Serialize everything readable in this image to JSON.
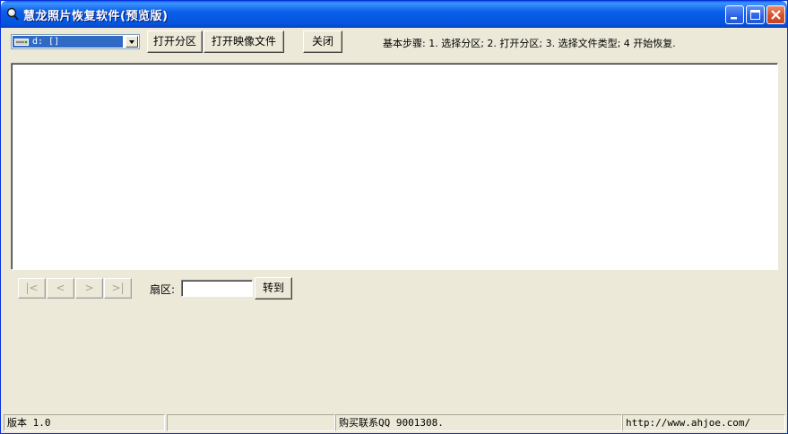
{
  "window": {
    "title": "慧龙照片恢复软件(预览版)"
  },
  "toolbar": {
    "drive_selected": "d: []",
    "open_partition_label": "打开分区",
    "open_image_label": "打开映像文件",
    "close_label": "关闭",
    "steps_text": "基本步骤: 1. 选择分区; 2. 打开分区; 3. 选择文件类型; 4 开始恢复."
  },
  "nav": {
    "first_label": "|<",
    "prev_label": "<",
    "next_label": ">",
    "last_label": ">|",
    "sector_label": "扇区:",
    "sector_value": "",
    "goto_label": "转到"
  },
  "statusbar": {
    "version": "版本 1.0",
    "empty": "",
    "contact": "购买联系QQ 9001308.",
    "url": "http://www.ahjoe.com/"
  },
  "colors": {
    "titlebar": "#0a5fe8",
    "selection": "#316ac5",
    "face": "#ece9d8"
  },
  "icons": {
    "app": "magnifier-app-icon",
    "drive": "hard-drive-icon",
    "minimize": "minimize-icon",
    "maximize": "maximize-icon",
    "close": "close-icon",
    "dropdown": "chevron-down-icon"
  }
}
